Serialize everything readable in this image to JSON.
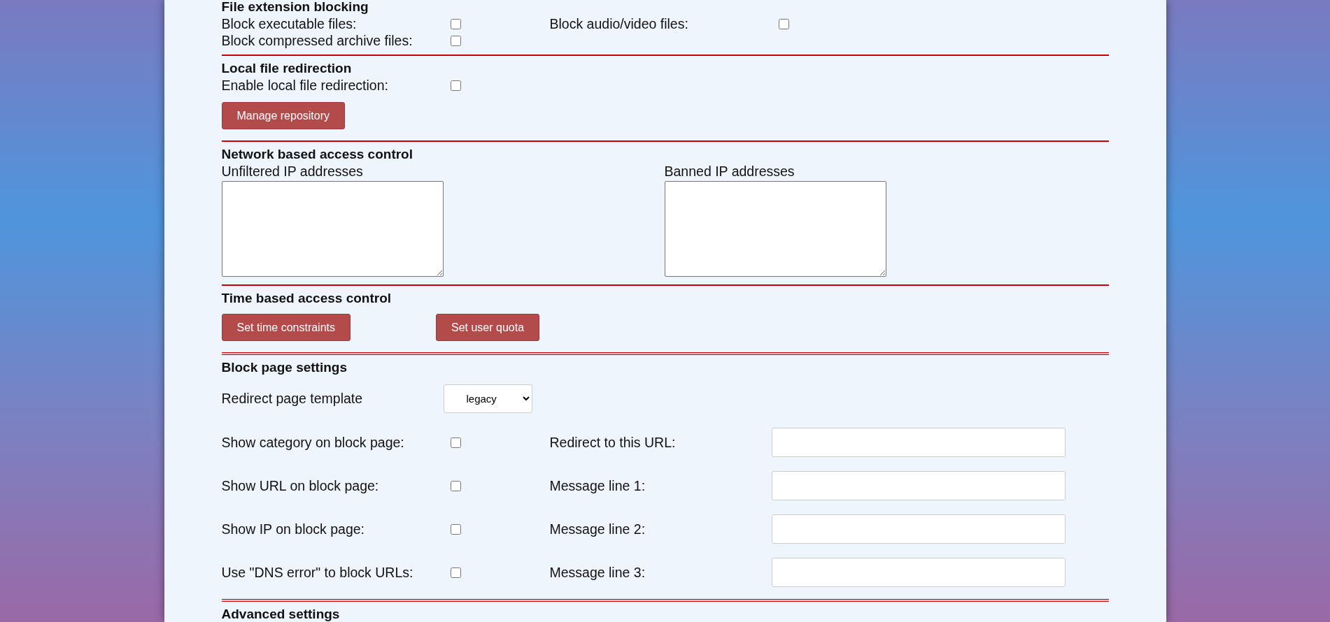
{
  "sections": [
    {
      "kind": "checkboxes",
      "rule_below": true,
      "rule_double": false,
      "heading": "File extension blocking",
      "options": [
        {
          "label": "Block executable files:",
          "checked": false
        },
        {
          "label": "Block audio/video files:",
          "checked": false
        },
        {
          "label": "Block compressed archive files:",
          "checked": false
        }
      ]
    },
    {
      "kind": "redirection",
      "rule_below": true,
      "rule_double": false,
      "heading": "Local file redirection",
      "options": [
        {
          "label": "Enable local file redirection:",
          "checked": false
        }
      ],
      "button": "Manage repository"
    },
    {
      "kind": "textareas",
      "rule_below": true,
      "rule_double": false,
      "heading": "Network based access control",
      "fields": [
        {
          "label": "Unfiltered IP addresses"
        },
        {
          "label": "Banned IP addresses"
        }
      ]
    },
    {
      "kind": "buttons",
      "rule_below": true,
      "rule_double": true,
      "heading": "Time based access control",
      "buttons": [
        "Set time constraints",
        "Set user quota"
      ]
    },
    {
      "kind": "block_page",
      "rule_below": true,
      "rule_double": true,
      "heading": "Block page settings",
      "template": {
        "label": "Redirect page template",
        "value": "legacy"
      },
      "rows": [
        {
          "option": {
            "label": "Show category on block page:",
            "checked": false
          },
          "field": {
            "label": "Redirect to this URL:"
          }
        },
        {
          "option": {
            "label": "Show URL on block page:",
            "checked": false
          },
          "field": {
            "label": "Message line 1:"
          }
        },
        {
          "option": {
            "label": "Show IP on block page:",
            "checked": false
          },
          "field": {
            "label": "Message line 2:"
          }
        },
        {
          "option": {
            "label": "Use \"DNS error\" to block URLs:",
            "checked": false
          },
          "field": {
            "label": "Message line 3:"
          }
        }
      ]
    },
    {
      "kind": "heading_only",
      "rule_below": false,
      "heading": "Advanced settings"
    }
  ]
}
